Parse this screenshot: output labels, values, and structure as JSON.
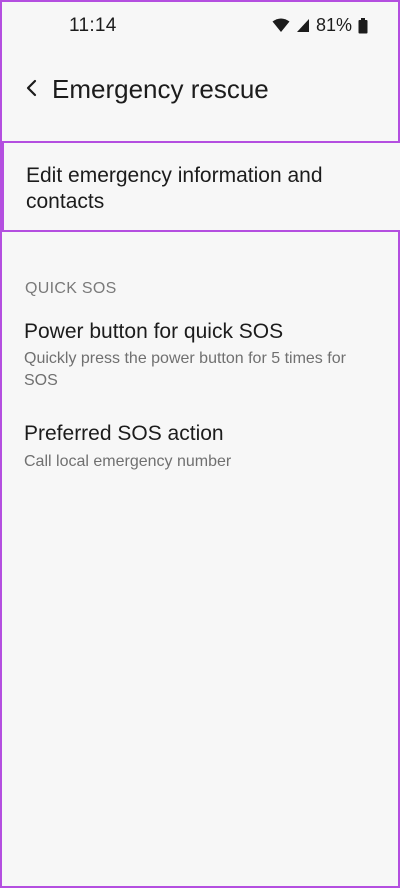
{
  "status_bar": {
    "time": "11:14",
    "battery": "81%",
    "icons": [
      "wifi-icon",
      "signal-icon",
      "battery-icon"
    ]
  },
  "header": {
    "back_icon": "chevron-left-icon",
    "title": "Emergency rescue"
  },
  "edit_emergency": {
    "label": "Edit emergency information and contacts"
  },
  "quick_sos": {
    "section_title": "QUICK SOS",
    "items": [
      {
        "title": "Power button for quick SOS",
        "description": "Quickly press the power button for 5 times for SOS"
      },
      {
        "title": "Preferred SOS action",
        "description": "Call local emergency number"
      }
    ]
  },
  "colors": {
    "highlight_border": "#b44fe0",
    "background": "#f7f7f7",
    "primary_text": "#1c1c1c",
    "secondary_text": "#707070"
  }
}
